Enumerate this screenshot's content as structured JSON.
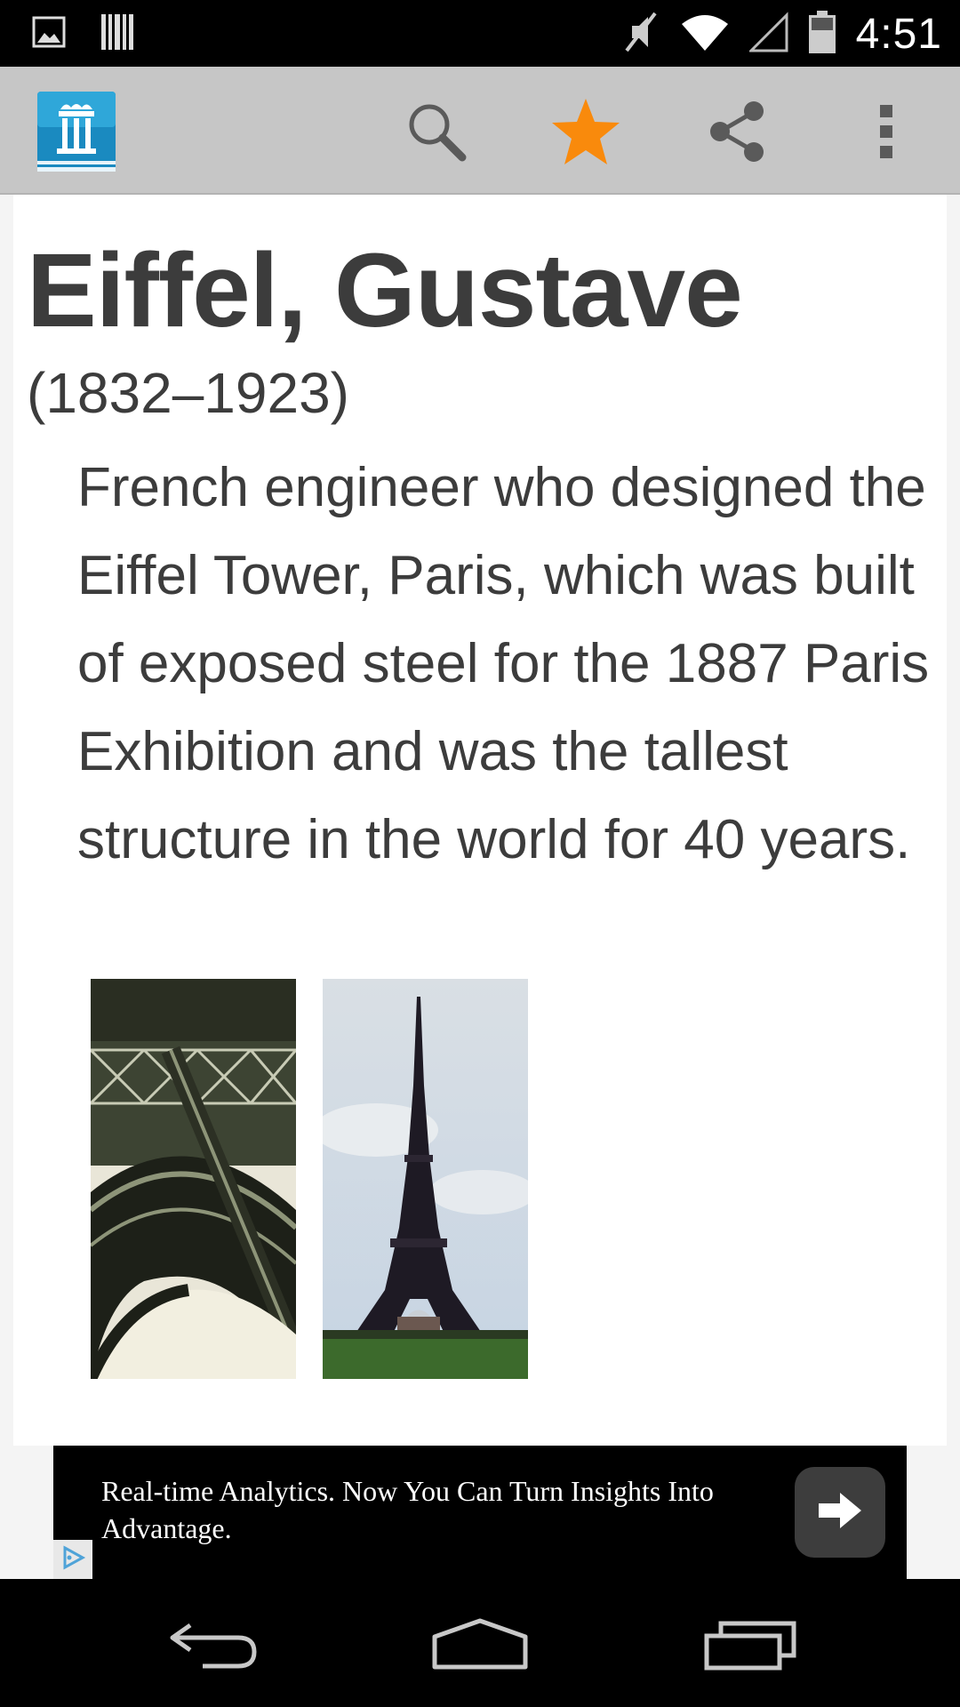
{
  "status_bar": {
    "time": "4:51",
    "left_icons": [
      "image-notification-icon",
      "barcode-notification-icon"
    ],
    "right_icons": [
      "mute-icon",
      "wifi-icon",
      "cell-signal-icon",
      "battery-icon"
    ]
  },
  "action_bar": {
    "icons": [
      "app-logo",
      "search-icon",
      "star-icon",
      "share-icon",
      "overflow-menu-icon"
    ],
    "star_color": "#f98a0c"
  },
  "entry": {
    "title": "Eiffel, Gustave",
    "dates": "(1832–1923)",
    "description": "French engineer who designed the Eiffel Tower, Paris, which was built of exposed steel for the 1887 Paris Exhibition and was the tallest structure in the world for 40 years.",
    "images": [
      "tower-ironwork-detail",
      "eiffel-tower-photo"
    ]
  },
  "ad": {
    "text": "Real-time Analytics. Now You Can Turn Insights Into Advantage.",
    "icons": [
      "arrow-right-icon",
      "adchoices-icon"
    ]
  },
  "nav_bar": {
    "icons": [
      "back-icon",
      "home-icon",
      "recent-apps-icon"
    ]
  }
}
